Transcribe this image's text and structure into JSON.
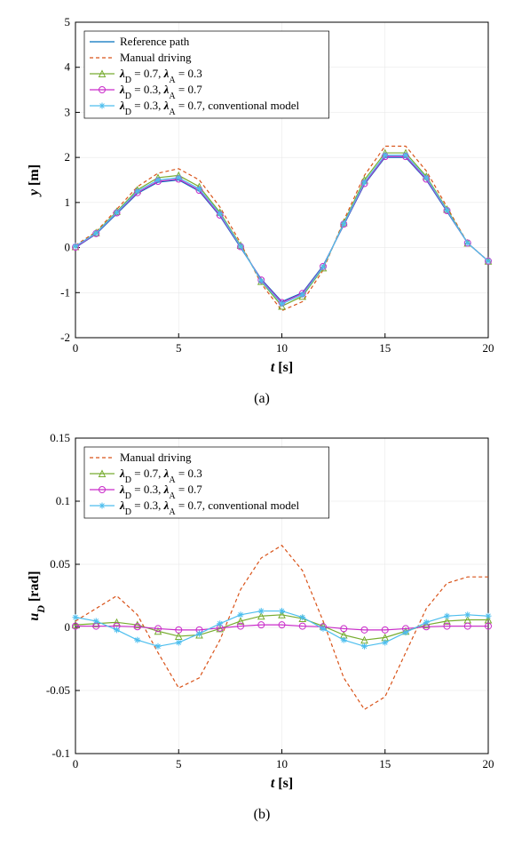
{
  "chart_data": [
    {
      "id": "chart-a",
      "type": "line",
      "sublabel": "(a)",
      "xlabel": "t [s]",
      "ylabel": "y [m]",
      "xlim": [
        0,
        20
      ],
      "ylim": [
        -2,
        5
      ],
      "xticks": [
        0,
        5,
        10,
        15,
        20
      ],
      "yticks": [
        -2,
        -1,
        0,
        1,
        2,
        3,
        4,
        5
      ],
      "legend_position": "top-left",
      "x": [
        0,
        1,
        2,
        3,
        4,
        5,
        6,
        7,
        8,
        9,
        10,
        11,
        12,
        13,
        14,
        15,
        16,
        17,
        18,
        19,
        20
      ],
      "series": [
        {
          "name": "Reference path",
          "color": "#0072BD",
          "dash": "",
          "marker": "",
          "values": [
            0,
            0.3,
            0.75,
            1.2,
            1.45,
            1.5,
            1.25,
            0.7,
            0,
            -0.7,
            -1.2,
            -1.0,
            -0.4,
            0.5,
            1.4,
            2.0,
            2.0,
            1.5,
            0.8,
            0.1,
            -0.3
          ]
        },
        {
          "name": "Manual driving",
          "color": "#D95319",
          "dash": "4 3",
          "marker": "",
          "values": [
            0.05,
            0.35,
            0.85,
            1.35,
            1.65,
            1.75,
            1.5,
            0.9,
            0.1,
            -0.8,
            -1.4,
            -1.2,
            -0.5,
            0.6,
            1.6,
            2.25,
            2.25,
            1.7,
            0.9,
            0.1,
            -0.3
          ]
        },
        {
          "name": "λD = 0.7, λA = 0.3",
          "label_tex": true,
          "color": "#77AC30",
          "dash": "",
          "marker": "triangle",
          "values": [
            0.02,
            0.33,
            0.8,
            1.28,
            1.55,
            1.6,
            1.35,
            0.78,
            0.05,
            -0.75,
            -1.3,
            -1.08,
            -0.45,
            0.55,
            1.5,
            2.1,
            2.1,
            1.58,
            0.85,
            0.1,
            -0.3
          ]
        },
        {
          "name": "λD = 0.3, λA = 0.7",
          "label_tex": true,
          "color": "#C92BC9",
          "dash": "",
          "marker": "circle",
          "values": [
            0.01,
            0.31,
            0.77,
            1.22,
            1.47,
            1.52,
            1.27,
            0.72,
            0.02,
            -0.72,
            -1.22,
            -1.02,
            -0.42,
            0.52,
            1.42,
            2.02,
            2.02,
            1.52,
            0.82,
            0.1,
            -0.3
          ]
        },
        {
          "name": "λD = 0.3, λA = 0.7, conventional model",
          "label_tex": true,
          "color": "#4DBEEE",
          "dash": "",
          "marker": "asterisk",
          "values": [
            0.03,
            0.32,
            0.78,
            1.25,
            1.5,
            1.55,
            1.3,
            0.75,
            0.03,
            -0.74,
            -1.25,
            -1.05,
            -0.43,
            0.53,
            1.45,
            2.05,
            2.05,
            1.55,
            0.83,
            0.1,
            -0.3
          ]
        }
      ]
    },
    {
      "id": "chart-b",
      "type": "line",
      "sublabel": "(b)",
      "xlabel": "t [s]",
      "ylabel": "uD [rad]",
      "xlim": [
        0,
        20
      ],
      "ylim": [
        -0.1,
        0.15
      ],
      "xticks": [
        0,
        5,
        10,
        15,
        20
      ],
      "yticks": [
        -0.1,
        -0.05,
        0,
        0.05,
        0.1,
        0.15
      ],
      "legend_position": "top-left",
      "x": [
        0,
        1,
        2,
        3,
        4,
        5,
        6,
        7,
        8,
        9,
        10,
        11,
        12,
        13,
        14,
        15,
        16,
        17,
        18,
        19,
        20
      ],
      "series": [
        {
          "name": "Manual driving",
          "color": "#D95319",
          "dash": "4 3",
          "marker": "",
          "values": [
            0.005,
            0.015,
            0.025,
            0.01,
            -0.02,
            -0.048,
            -0.04,
            -0.01,
            0.03,
            0.055,
            0.065,
            0.045,
            0.005,
            -0.04,
            -0.065,
            -0.055,
            -0.02,
            0.015,
            0.035,
            0.04,
            0.04
          ]
        },
        {
          "name": "λD = 0.7, λA = 0.3",
          "label_tex": true,
          "color": "#77AC30",
          "dash": "",
          "marker": "triangle",
          "values": [
            0.002,
            0.003,
            0.004,
            0.002,
            -0.003,
            -0.007,
            -0.006,
            -0.001,
            0.005,
            0.009,
            0.01,
            0.007,
            0.001,
            -0.006,
            -0.01,
            -0.008,
            -0.003,
            0.002,
            0.005,
            0.006,
            0.006
          ]
        },
        {
          "name": "λD = 0.3, λA = 0.7",
          "label_tex": true,
          "color": "#C92BC9",
          "dash": "",
          "marker": "circle",
          "values": [
            0.001,
            0.001,
            0.001,
            0.0005,
            -0.001,
            -0.002,
            -0.002,
            -0.0005,
            0.001,
            0.002,
            0.002,
            0.001,
            0.0005,
            -0.001,
            -0.002,
            -0.002,
            -0.001,
            0.0005,
            0.001,
            0.001,
            0.001
          ]
        },
        {
          "name": "λD = 0.3, λA = 0.7, conventional model",
          "label_tex": true,
          "color": "#4DBEEE",
          "dash": "",
          "marker": "asterisk",
          "values": [
            0.008,
            0.005,
            -0.002,
            -0.01,
            -0.015,
            -0.012,
            -0.005,
            0.003,
            0.01,
            0.013,
            0.013,
            0.008,
            -0.001,
            -0.01,
            -0.015,
            -0.012,
            -0.004,
            0.004,
            0.009,
            0.01,
            0.009
          ]
        }
      ]
    }
  ]
}
